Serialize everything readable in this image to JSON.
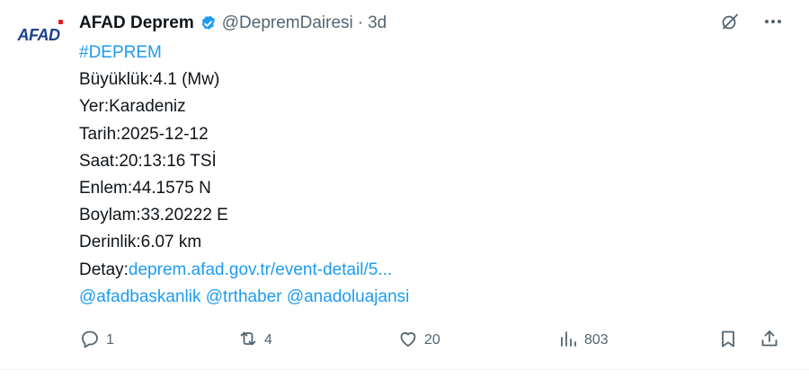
{
  "account": {
    "logo_text": "AFAD",
    "display_name": "AFAD Deprem",
    "handle": "@DepremDairesi",
    "separator": "·",
    "time": "3d"
  },
  "tweet": {
    "hashtag": "#DEPREM",
    "lines": [
      "Büyüklük:4.1 (Mw)",
      "Yer:Karadeniz",
      "Tarih:2025-12-12",
      "Saat:20:13:16 TSİ",
      "Enlem:44.1575 N",
      "Boylam:33.20222 E",
      "Derinlik:6.07 km"
    ],
    "detail_label": "Detay:",
    "detail_link": "deprem.afad.gov.tr/event-detail/5...",
    "mentions": [
      "@afadbaskanlik",
      "@trthaber",
      "@anadoluajansi"
    ]
  },
  "actions": {
    "replies": "1",
    "retweets": "4",
    "likes": "20",
    "views": "803"
  },
  "colors": {
    "link": "#1d9bf0",
    "muted": "#536471",
    "text": "#0f1419",
    "verified": "#1d9bf0",
    "logo_blue": "#1b3f8f",
    "logo_red": "#e1201f"
  },
  "icons": {
    "verified": "verified-badge-icon",
    "grok": "grok-icon",
    "more": "more-icon",
    "reply": "reply-icon",
    "retweet": "retweet-icon",
    "like": "heart-icon",
    "views": "views-chart-icon",
    "bookmark": "bookmark-icon",
    "share": "share-icon"
  }
}
